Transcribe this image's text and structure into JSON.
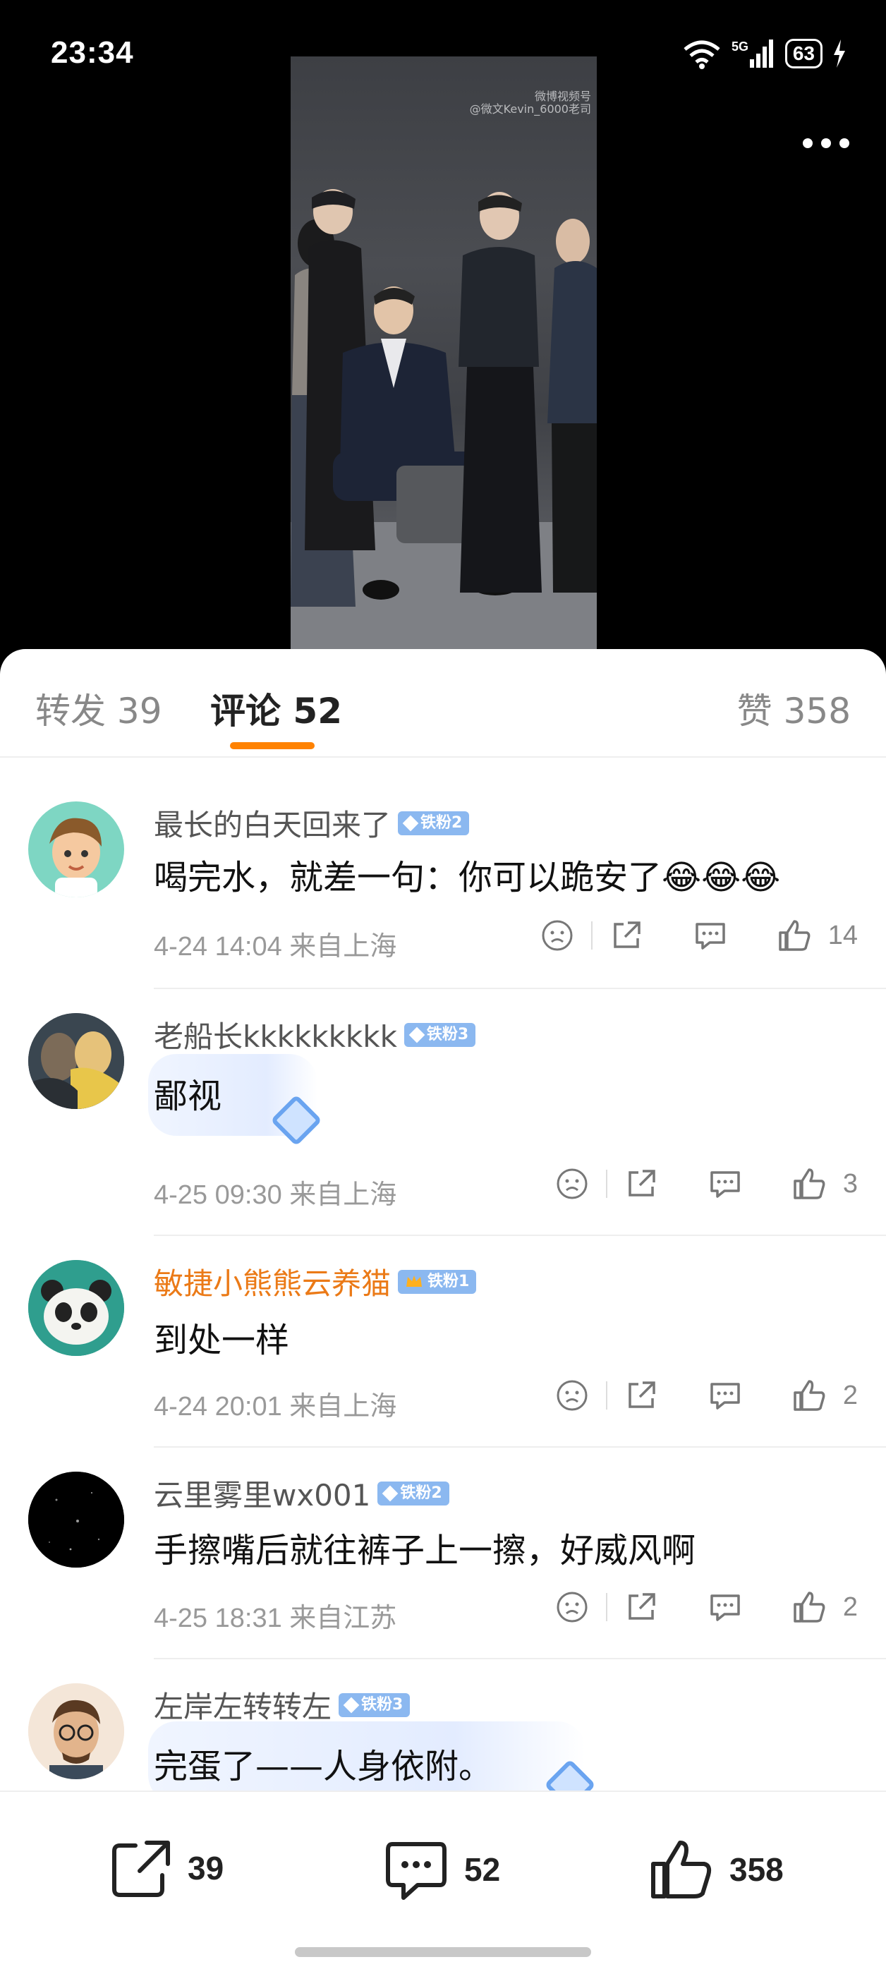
{
  "status_bar": {
    "time": "23:34",
    "battery": "63",
    "network": "5G"
  },
  "video": {
    "watermark_line1": "微博视频号",
    "watermark_line2": "@微文Kevin_6000老司"
  },
  "tabs": {
    "repost": "转发 39",
    "comments": "评论 52",
    "likes": "赞 358"
  },
  "comments": [
    {
      "user": "最长的白天回来了",
      "badge": "铁粉2",
      "text": "喝完水，就差一句：你可以跪安了😂😂😂",
      "meta": "4-24 14:04  来自上海",
      "likes": "14"
    },
    {
      "user": "老船长kkkkkkkkk",
      "badge": "铁粉3",
      "text": "鄙视",
      "meta": "4-25 09:30  来自上海",
      "likes": "3"
    },
    {
      "user": "敏捷小熊熊云养猫",
      "badge": "铁粉1",
      "text": "到处一样",
      "meta": "4-24 20:01  来自上海",
      "likes": "2"
    },
    {
      "user": "云里雾里wx001",
      "badge": "铁粉2",
      "text": "手擦嘴后就往裤子上一擦，好威风啊",
      "meta": "4-25 18:31  来自江苏",
      "likes": "2"
    },
    {
      "user": "左岸左转转左",
      "badge": "铁粉3",
      "text": "完蛋了——人身依附。"
    }
  ],
  "bottom_bar": {
    "repost_count": "39",
    "comment_count": "52",
    "like_count": "358"
  },
  "colors": {
    "accent": "#ff8200",
    "badge": "#8bb8f0",
    "vip_name": "#eb7a17"
  }
}
